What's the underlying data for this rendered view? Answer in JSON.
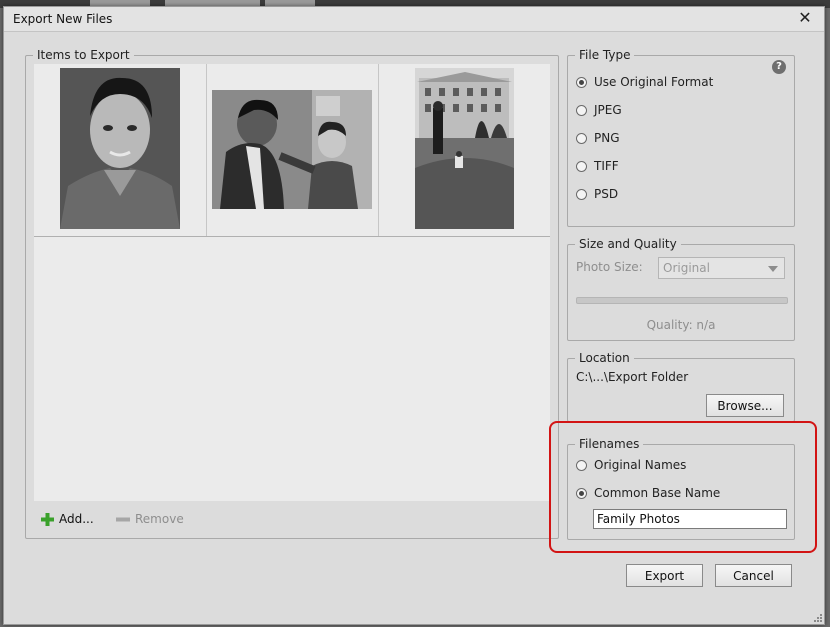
{
  "dialog": {
    "title": "Export New Files",
    "close_glyph": "✕"
  },
  "items_group": {
    "legend": "Items to Export",
    "photos": [
      "portrait-young-man",
      "man-and-boy",
      "building-lawn-figures"
    ],
    "add_label": "Add...",
    "remove_label": "Remove"
  },
  "file_type": {
    "legend": "File Type",
    "help_glyph": "?",
    "options": [
      {
        "label": "Use Original Format",
        "checked": true
      },
      {
        "label": "JPEG",
        "checked": false
      },
      {
        "label": "PNG",
        "checked": false
      },
      {
        "label": "TIFF",
        "checked": false
      },
      {
        "label": "PSD",
        "checked": false
      }
    ]
  },
  "size_quality": {
    "legend": "Size and Quality",
    "photo_size_label": "Photo Size:",
    "photo_size_value": "Original",
    "quality_text": "Quality: n/a"
  },
  "location": {
    "legend": "Location",
    "path": "C:\\...\\Export Folder",
    "browse_label": "Browse..."
  },
  "filenames": {
    "legend": "Filenames",
    "options": [
      {
        "label": "Original Names",
        "checked": false
      },
      {
        "label": "Common Base Name",
        "checked": true
      }
    ],
    "base_name_value": "Family Photos"
  },
  "buttons": {
    "export_label": "Export",
    "cancel_label": "Cancel"
  },
  "colors": {
    "highlight": "#d21414",
    "add_icon": "#3aa12b",
    "dialog_bg": "#dcdcdc"
  }
}
